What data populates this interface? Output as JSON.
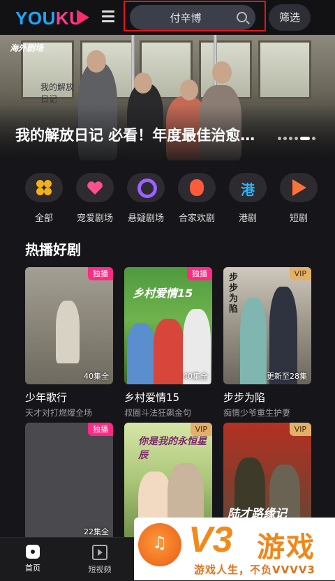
{
  "header": {
    "logo_text": "YOUKU",
    "search_value": "付辛博",
    "filter_label": "筛选"
  },
  "banner": {
    "tag": "海外剧场",
    "poster_text": "我的解放日记",
    "title": "我的解放日记 必看！年度最佳治愈…"
  },
  "categories": [
    {
      "label": "全部",
      "icon": "clover-icon",
      "color": "#f2b21c"
    },
    {
      "label": "宠爱剧场",
      "icon": "heart-icon",
      "color": "#ff4f8f"
    },
    {
      "label": "悬疑剧场",
      "icon": "magnifier-q-icon",
      "color": "#9a62ff"
    },
    {
      "label": "合家欢剧",
      "icon": "lantern-icon",
      "color": "#ff5b3b"
    },
    {
      "label": "港剧",
      "icon": "gang-text-icon",
      "icon_text": "港",
      "color": "#28b6ff"
    },
    {
      "label": "短剧",
      "icon": "play-icon",
      "color": "#ff7136"
    }
  ],
  "section": {
    "title": "热播好剧"
  },
  "cards": [
    {
      "title": "少年歌行",
      "subtitle": "天才对打燃爆全场",
      "badge": "独播",
      "badge_type": "exclusive",
      "episodes": "40集全"
    },
    {
      "title": "乡村爱情15",
      "subtitle": "叔圈斗法狂飙金句",
      "badge": "独播",
      "badge_type": "exclusive",
      "episodes": "40集全",
      "poster_text": "乡村爱情15"
    },
    {
      "title": "步步为陷",
      "subtitle": "痴情少爷重生护妻",
      "badge": "VIP",
      "badge_type": "vip",
      "episodes": "更新至28集",
      "poster_text": "步步为陷"
    },
    {
      "title": "",
      "subtitle": "",
      "badge": "独播",
      "badge_type": "exclusive",
      "episodes": "22集全"
    },
    {
      "title": "",
      "subtitle": "",
      "badge": "VIP",
      "badge_type": "vip",
      "episodes": "",
      "poster_text": "你是我的永恒星辰"
    },
    {
      "title": "",
      "subtitle": "",
      "badge": "VIP",
      "badge_type": "vip",
      "episodes": "",
      "poster_text": "陆才路缘记"
    }
  ],
  "bottom_nav": [
    {
      "label": "首页",
      "icon": "home-icon",
      "active": true
    },
    {
      "label": "短视频",
      "icon": "short-video-icon",
      "active": false
    }
  ],
  "watermark": {
    "brand": "V3",
    "brand_cn": "游戏",
    "slogan": "游戏人生，不负VVVV3"
  }
}
